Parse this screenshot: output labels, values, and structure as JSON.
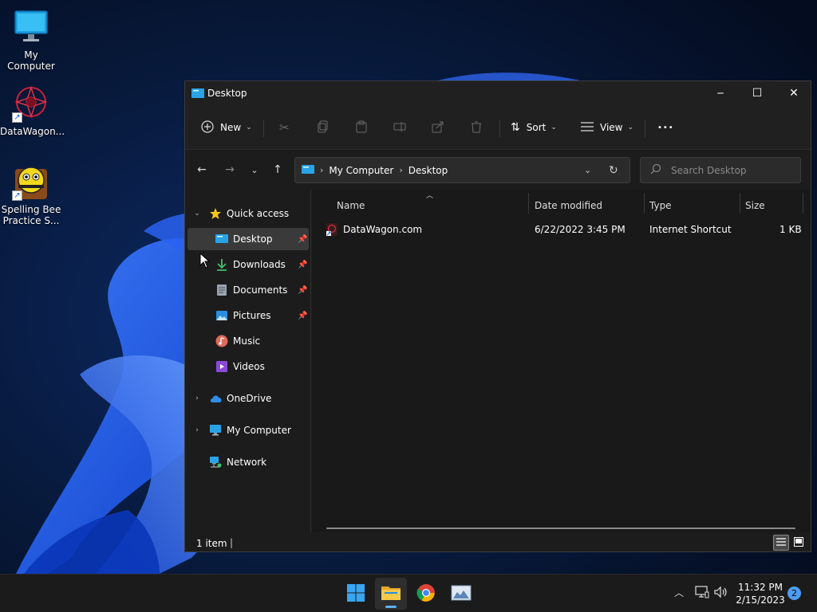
{
  "desktop": {
    "icons": [
      {
        "label": "My Computer"
      },
      {
        "label": "DataWagon..."
      },
      {
        "label": "Spelling Bee Practice S..."
      }
    ]
  },
  "window": {
    "title": "Desktop",
    "controls": {
      "minimize": "─",
      "maximize": "☐",
      "close": "✕"
    }
  },
  "toolbar": {
    "new_label": "New",
    "sort_label": "Sort",
    "view_label": "View",
    "more_label": "•••"
  },
  "address": {
    "crumbs": [
      "My Computer",
      "Desktop"
    ]
  },
  "search": {
    "placeholder": "Search Desktop"
  },
  "sidebar": {
    "items": [
      {
        "label": "Quick access"
      },
      {
        "label": "Desktop"
      },
      {
        "label": "Downloads"
      },
      {
        "label": "Documents"
      },
      {
        "label": "Pictures"
      },
      {
        "label": "Music"
      },
      {
        "label": "Videos"
      },
      {
        "label": "OneDrive"
      },
      {
        "label": "My Computer"
      },
      {
        "label": "Network"
      }
    ]
  },
  "columns": [
    "Name",
    "Date modified",
    "Type",
    "Size"
  ],
  "files": [
    {
      "name": "DataWagon.com",
      "date": "6/22/2022 3:45 PM",
      "type": "Internet Shortcut",
      "size": "1 KB"
    }
  ],
  "status": {
    "count": "1 item",
    "caret": "|"
  },
  "taskbar": {
    "clock_time": "11:32 PM",
    "clock_date": "2/15/2023",
    "notifications": "2"
  },
  "colors": {
    "accent": "#5fb2f2",
    "window_bg": "#1c1c1c",
    "selected_item": "#3a3a3a",
    "taskbar_bg": "#1b1b1b"
  }
}
